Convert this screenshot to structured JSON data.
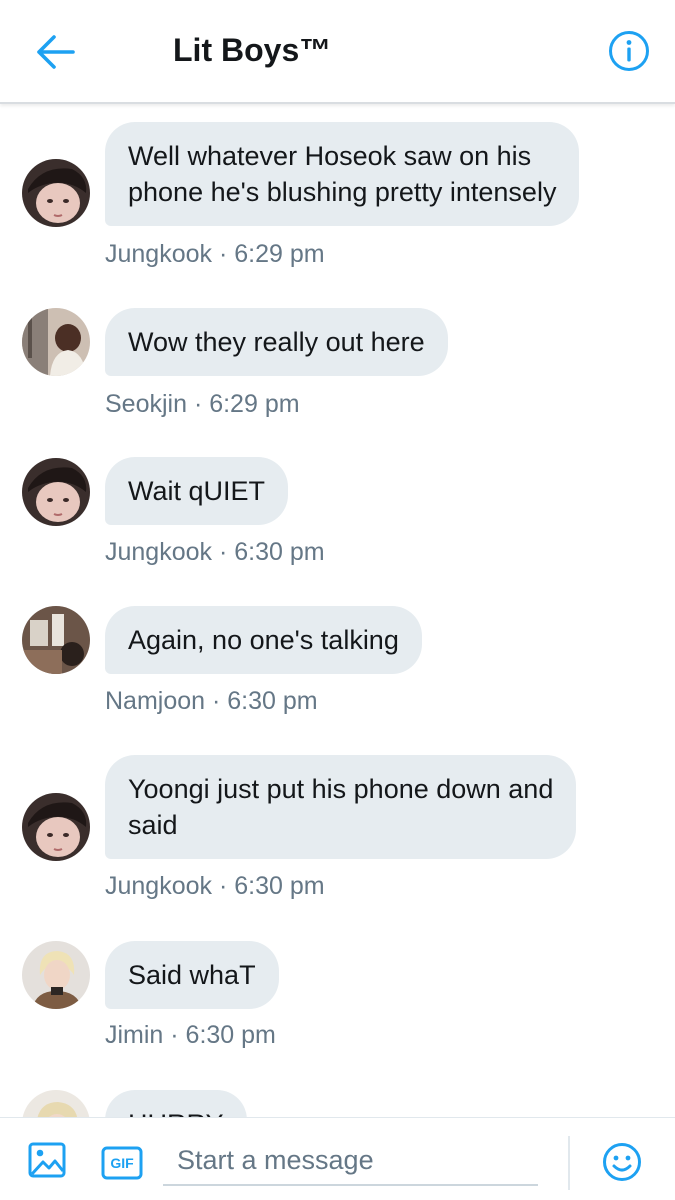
{
  "header": {
    "title": "Lit Boys™",
    "back_icon": "arrow-left-icon",
    "info_icon": "info-icon"
  },
  "colors": {
    "accent": "#1da1f2",
    "bubble": "#e6ecf0",
    "meta_text": "#657786"
  },
  "messages": [
    {
      "text_lines": [
        "Well whatever Hoseok saw on his",
        "phone he's blushing pretty intensely"
      ],
      "meta": "Jungkook · 6:29 pm"
    },
    {
      "text_lines": [
        "Wow they really out here"
      ],
      "meta": "Seokjin · 6:29 pm"
    },
    {
      "text_lines": [
        "Wait qUIET"
      ],
      "meta": "Jungkook · 6:30 pm"
    },
    {
      "text_lines": [
        "Again, no one's talking"
      ],
      "meta": "Namjoon · 6:30 pm"
    },
    {
      "text_lines": [
        "Yoongi just put his phone down and",
        "said"
      ],
      "meta": "Jungkook · 6:30 pm"
    },
    {
      "text_lines": [
        "Said whaT"
      ],
      "meta": "Jimin · 6:30 pm"
    },
    {
      "text_lines": [
        "HURRY"
      ],
      "meta": ""
    }
  ],
  "composer": {
    "placeholder": "Start a message",
    "gif_label": "GIF",
    "image_icon": "image-icon",
    "emoji_icon": "emoji-icon"
  }
}
